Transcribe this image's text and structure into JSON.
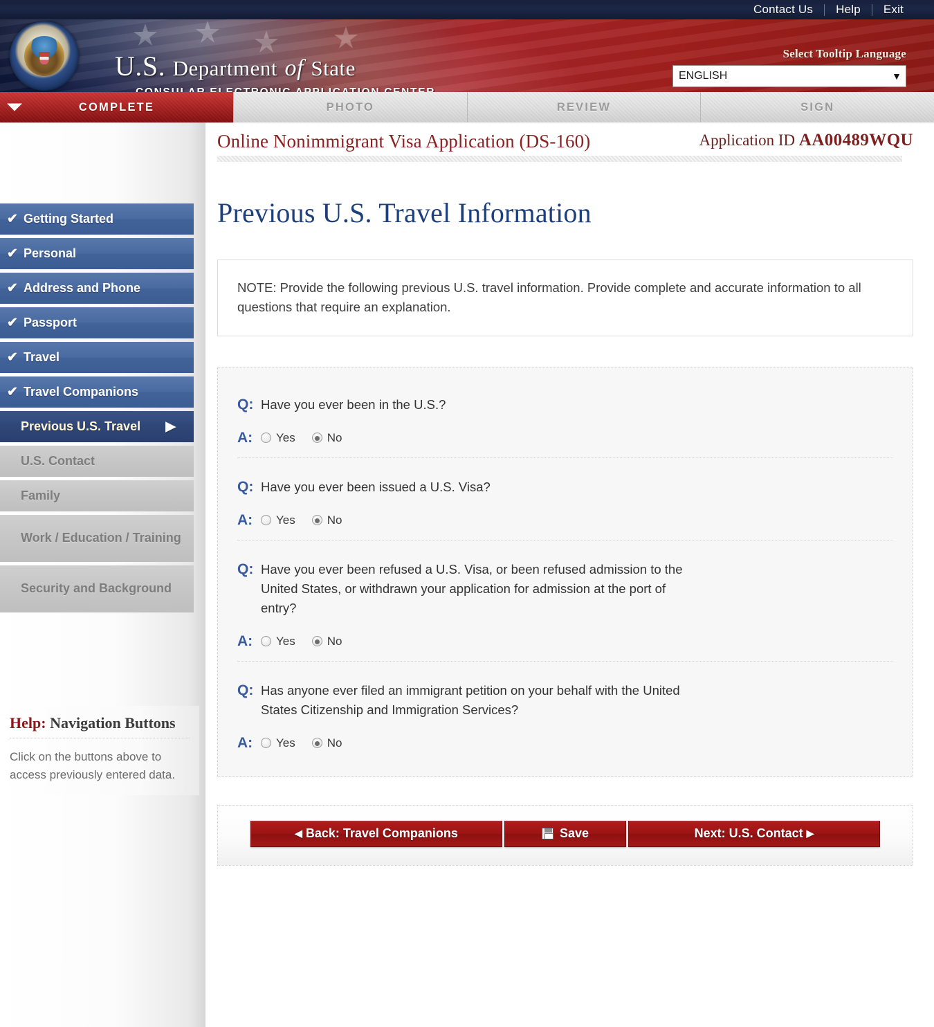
{
  "utility": {
    "links": [
      "Contact Us",
      "Help",
      "Exit"
    ]
  },
  "banner": {
    "title_us": "U.S.",
    "title_department": "Department",
    "title_of": "of",
    "title_state": "State",
    "subtitle": "CONSULAR ELECTRONIC APPLICATION CENTER",
    "language_label": "Select Tooltip Language",
    "language_value": "ENGLISH",
    "caret": "▼"
  },
  "tabs": [
    {
      "label": "COMPLETE",
      "state": "active"
    },
    {
      "label": "PHOTO",
      "state": "inactive"
    },
    {
      "label": "REVIEW",
      "state": "inactive"
    },
    {
      "label": "SIGN",
      "state": "inactive"
    }
  ],
  "sidebar": {
    "items": [
      {
        "label": "Getting Started",
        "state": "done",
        "check": "✔"
      },
      {
        "label": "Personal",
        "state": "done",
        "check": "✔"
      },
      {
        "label": "Address and Phone",
        "state": "done",
        "check": "✔"
      },
      {
        "label": "Passport",
        "state": "done",
        "check": "✔"
      },
      {
        "label": "Travel",
        "state": "done",
        "check": "✔"
      },
      {
        "label": "Travel Companions",
        "state": "done",
        "check": "✔"
      },
      {
        "label": "Previous U.S. Travel",
        "state": "active",
        "arrow": "▶"
      },
      {
        "label": "U.S. Contact",
        "state": "future"
      },
      {
        "label": "Family",
        "state": "future"
      },
      {
        "label": "Work / Education / Training",
        "state": "future"
      },
      {
        "label": "Security and Background",
        "state": "future"
      }
    ],
    "help": {
      "title_prefix": "Help:",
      "title_main": "Navigation Buttons",
      "body": "Click on the buttons above to access previously entered data."
    }
  },
  "content": {
    "breadcrumb_title": "Online Nonimmigrant Visa Application (DS-160)",
    "application_id_label": "Application ID",
    "application_id_value": "AA00489WQU",
    "page_title": "Previous U.S. Travel Information",
    "note": "NOTE: Provide the following previous U.S. travel information. Provide complete and accurate information to all questions that require an explanation.",
    "q_marker": "Q:",
    "a_marker": "A:",
    "questions": [
      {
        "question": "Have you ever been in the U.S.?",
        "options": [
          "Yes",
          "No"
        ],
        "selected": "No"
      },
      {
        "question": "Have you ever been issued a U.S. Visa?",
        "options": [
          "Yes",
          "No"
        ],
        "selected": "No"
      },
      {
        "question": "Have you ever been refused a U.S. Visa, or been refused admission to the United States, or withdrawn your application for admission at the port of entry?",
        "options": [
          "Yes",
          "No"
        ],
        "selected": "No"
      },
      {
        "question": "Has anyone ever filed an immigrant petition on your behalf with the United States Citizenship and Immigration Services?",
        "options": [
          "Yes",
          "No"
        ],
        "selected": "No"
      }
    ]
  },
  "footer": {
    "back_label": "Back: Travel Companions",
    "back_arrow": "◀",
    "save_label": "Save",
    "next_label": "Next: U.S. Contact",
    "next_arrow": "▶"
  },
  "colors": {
    "brand_red": "#a8252a",
    "nav_blue": "#44659d",
    "nav_active_blue": "#2f4677",
    "title_blue": "#1d3f7a",
    "crumb_red": "#8a2222"
  }
}
